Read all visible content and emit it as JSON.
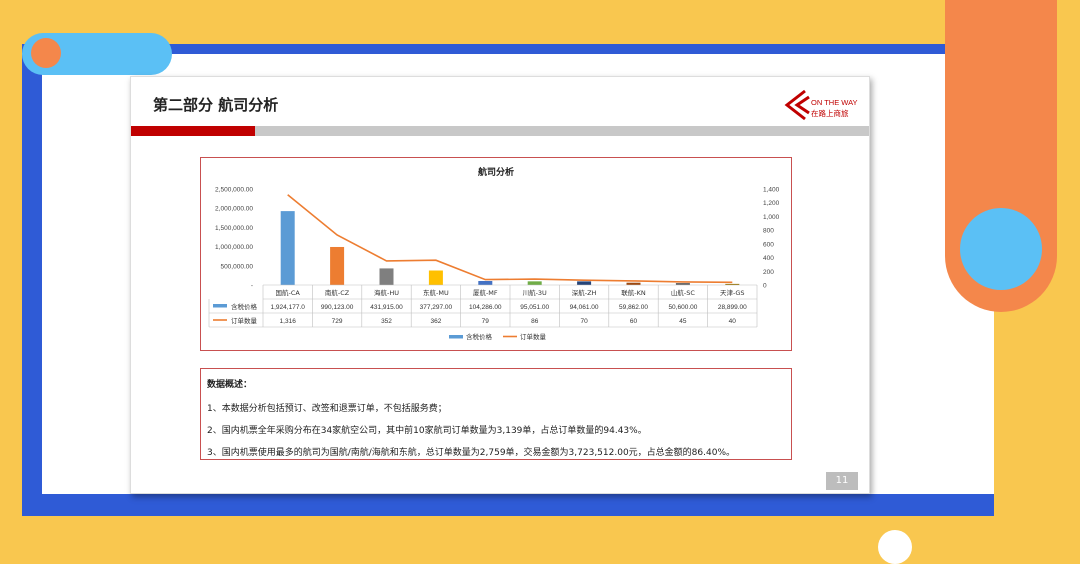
{
  "slide": {
    "title": "第二部分  航司分析",
    "logo_text_top": "ON THE WAY",
    "logo_text_bottom": "在路上商旅",
    "page_number": "11"
  },
  "chart_data": {
    "type": "bar",
    "title": "航司分析",
    "categories": [
      "国航-CA",
      "南航-CZ",
      "海航-HU",
      "东航-MU",
      "厦航-MF",
      "川航-3U",
      "深航-ZH",
      "联航-KN",
      "山航-SC",
      "天津-GS"
    ],
    "series": [
      {
        "name": "含税价格",
        "type": "bar",
        "axis": "left",
        "values": [
          1924177.0,
          990123.0,
          431915.0,
          377297.0,
          104286.0,
          95051.0,
          94061.0,
          59862.0,
          50600.0,
          28899.0
        ],
        "labels": [
          "1,924,177.0",
          "990,123.00",
          "431,915.00",
          "377,297.00",
          "104,286.00",
          "95,051.00",
          "94,061.00",
          "59,862.00",
          "50,600.00",
          "28,899.00"
        ]
      },
      {
        "name": "订单数量",
        "type": "line",
        "axis": "right",
        "values": [
          1316,
          729,
          352,
          362,
          79,
          86,
          70,
          60,
          45,
          40
        ],
        "labels": [
          "1,316",
          "729",
          "352",
          "362",
          "79",
          "86",
          "70",
          "60",
          "45",
          "40"
        ]
      }
    ],
    "bar_colors": [
      "#5b9bd5",
      "#ed7d31",
      "#7f7f7f",
      "#ffc000",
      "#4472c4",
      "#70ad47",
      "#264478",
      "#9e480e",
      "#636363",
      "#997300"
    ],
    "line_color": "#ed7d31",
    "legend_bar_color": "#5b9bd5",
    "y_left_ticks": [
      "2,500,000.00",
      "2,000,000.00",
      "1,500,000.00",
      "1,000,000.00",
      "500,000.00",
      "-"
    ],
    "y_left_range": [
      0,
      2500000
    ],
    "y_right_ticks": [
      "1,400",
      "1,200",
      "1,000",
      "800",
      "600",
      "400",
      "200",
      "0"
    ],
    "y_right_range": [
      0,
      1400
    ],
    "legend_position": "bottom"
  },
  "description": {
    "heading": "数据概述：",
    "lines": [
      "1、本数据分析包括预订、改签和退票订单，不包括服务费；",
      "2、国内机票全年采购分布在34家航空公司，其中前10家航司订单数量为3,139单，占总订单数量的94.43%。",
      "3、国内机票使用最多的航司为国航/南航/海航和东航，总订单数量为2,759单，交易金额为3,723,512.00元，占总金额的86.40%。"
    ]
  }
}
